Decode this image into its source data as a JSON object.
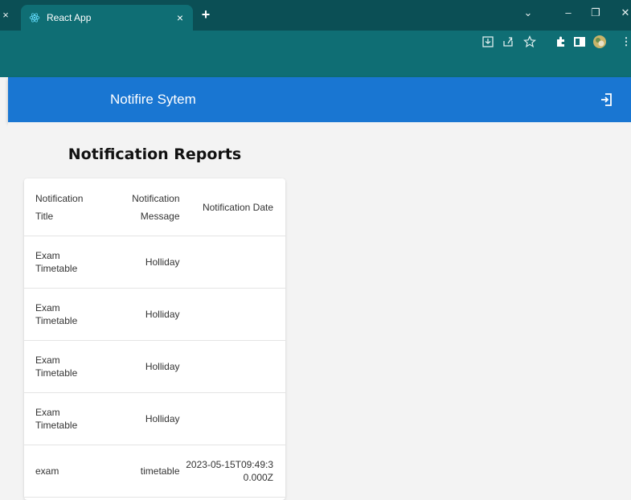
{
  "browser": {
    "tab_title": "React App",
    "tab_close": "×",
    "new_tab": "+",
    "left_close": "×",
    "window_controls": {
      "dropdown": "⌄",
      "minimize": "–",
      "restore": "❐",
      "close": "✕"
    },
    "toolbar_icons": [
      "download-icon",
      "share-icon",
      "star-icon",
      "extensions-icon",
      "sidepanel-icon",
      "avatar",
      "menu-icon"
    ]
  },
  "appbar": {
    "title": "Notifire Sytem",
    "color": "#1976d2"
  },
  "page": {
    "heading": "Notification Reports"
  },
  "table": {
    "headers": [
      "Notification Title",
      "Notification Message",
      "Notification Date"
    ],
    "rows": [
      {
        "title": "Exam Timetable",
        "message": "Holliday",
        "date": ""
      },
      {
        "title": "Exam Timetable",
        "message": "Holliday",
        "date": ""
      },
      {
        "title": "Exam Timetable",
        "message": "Holliday",
        "date": ""
      },
      {
        "title": "Exam Timetable",
        "message": "Holliday",
        "date": ""
      },
      {
        "title": "exam",
        "message": "timetable",
        "date": "2023-05-15T09:49:30.000Z"
      }
    ]
  }
}
